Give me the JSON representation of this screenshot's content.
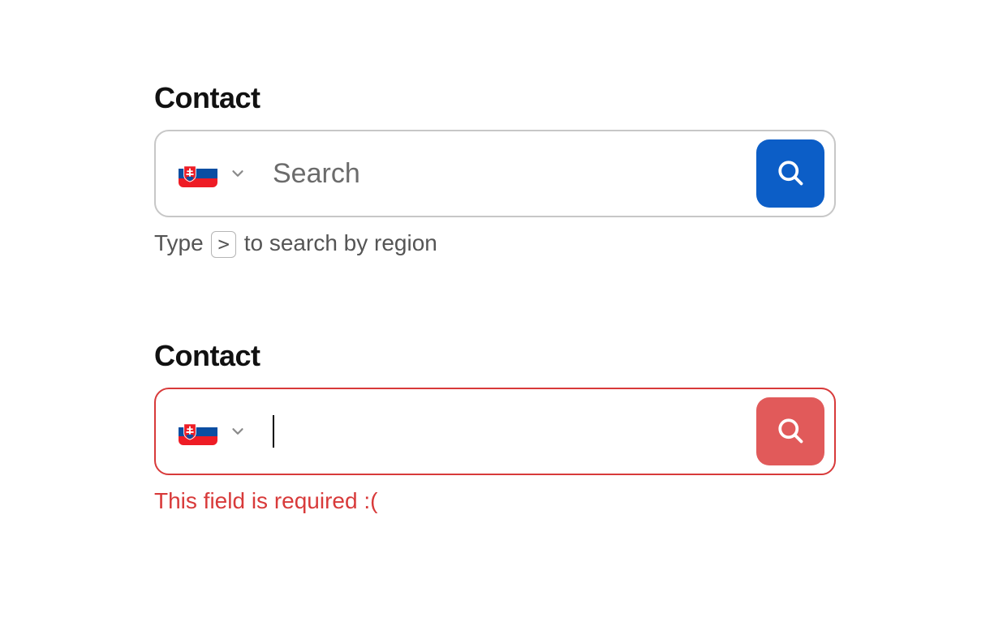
{
  "fields": [
    {
      "label": "Contact",
      "placeholder": "Search",
      "value": "",
      "country_code": "sk",
      "state": "default",
      "helper_prefix": "Type ",
      "helper_key": ">",
      "helper_suffix": " to search by region",
      "button_color": "primary"
    },
    {
      "label": "Contact",
      "placeholder": "",
      "value": "",
      "country_code": "sk",
      "state": "error",
      "error_message": "This field is required :(",
      "button_color": "danger"
    }
  ]
}
